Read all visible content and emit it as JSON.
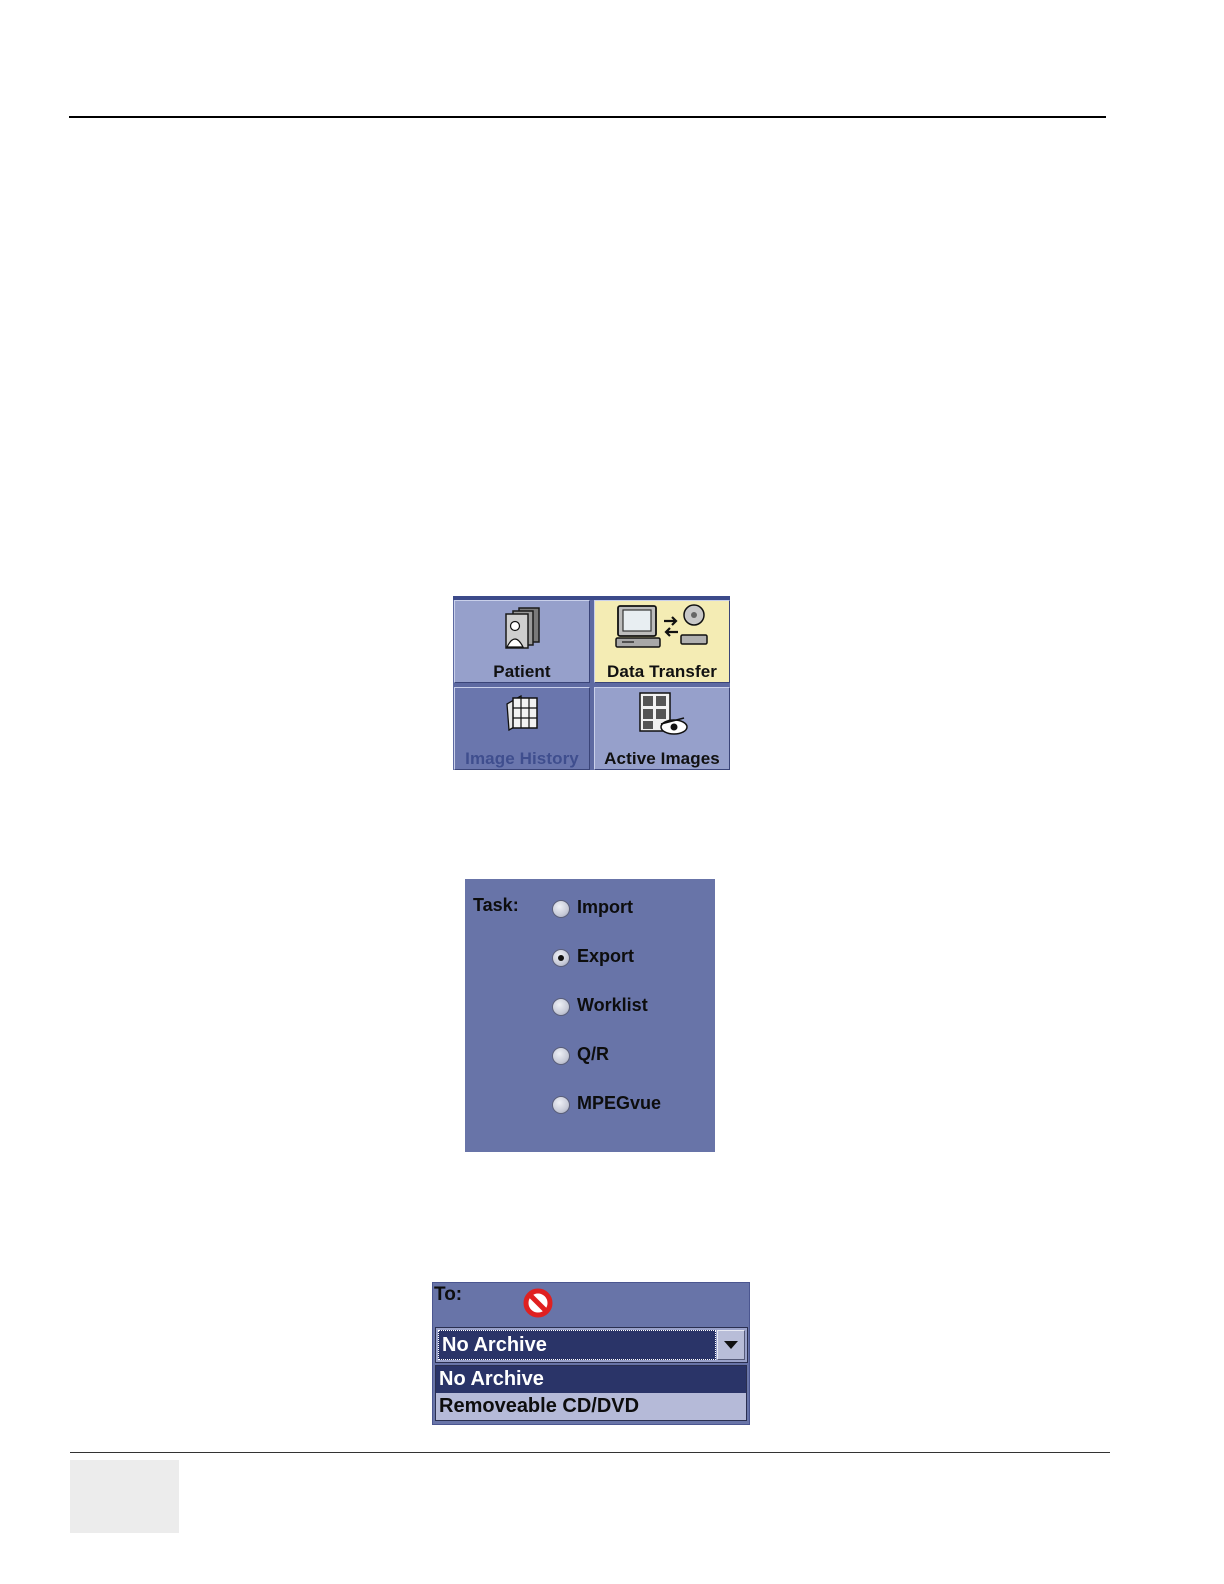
{
  "tab_buttons": [
    {
      "label": "Patient",
      "icon": "patient-folder-icon",
      "state": "normal"
    },
    {
      "label": "Data Transfer",
      "icon": "data-transfer-icon",
      "state": "active"
    },
    {
      "label": "Image History",
      "icon": "image-history-icon",
      "state": "disabled"
    },
    {
      "label": "Active Images",
      "icon": "active-images-icon",
      "state": "normal"
    }
  ],
  "task_panel": {
    "label": "Task:",
    "options": [
      {
        "label": "Import",
        "selected": false
      },
      {
        "label": "Export",
        "selected": true
      },
      {
        "label": "Worklist",
        "selected": false
      },
      {
        "label": "Q/R",
        "selected": false
      },
      {
        "label": "MPEGvue",
        "selected": false
      }
    ]
  },
  "destination_panel": {
    "label": "To:",
    "status_icon": "no-entry-icon",
    "selected_value": "No Archive",
    "options": [
      {
        "label": "No Archive",
        "highlighted": true
      },
      {
        "label": "Removeable CD/DVD",
        "highlighted": false
      }
    ]
  },
  "colors": {
    "panel_bg": "#6874a8",
    "button_bg": "#96a0cb",
    "button_active_bg": "#f4ecb4",
    "selection_bg": "#2a3468"
  }
}
